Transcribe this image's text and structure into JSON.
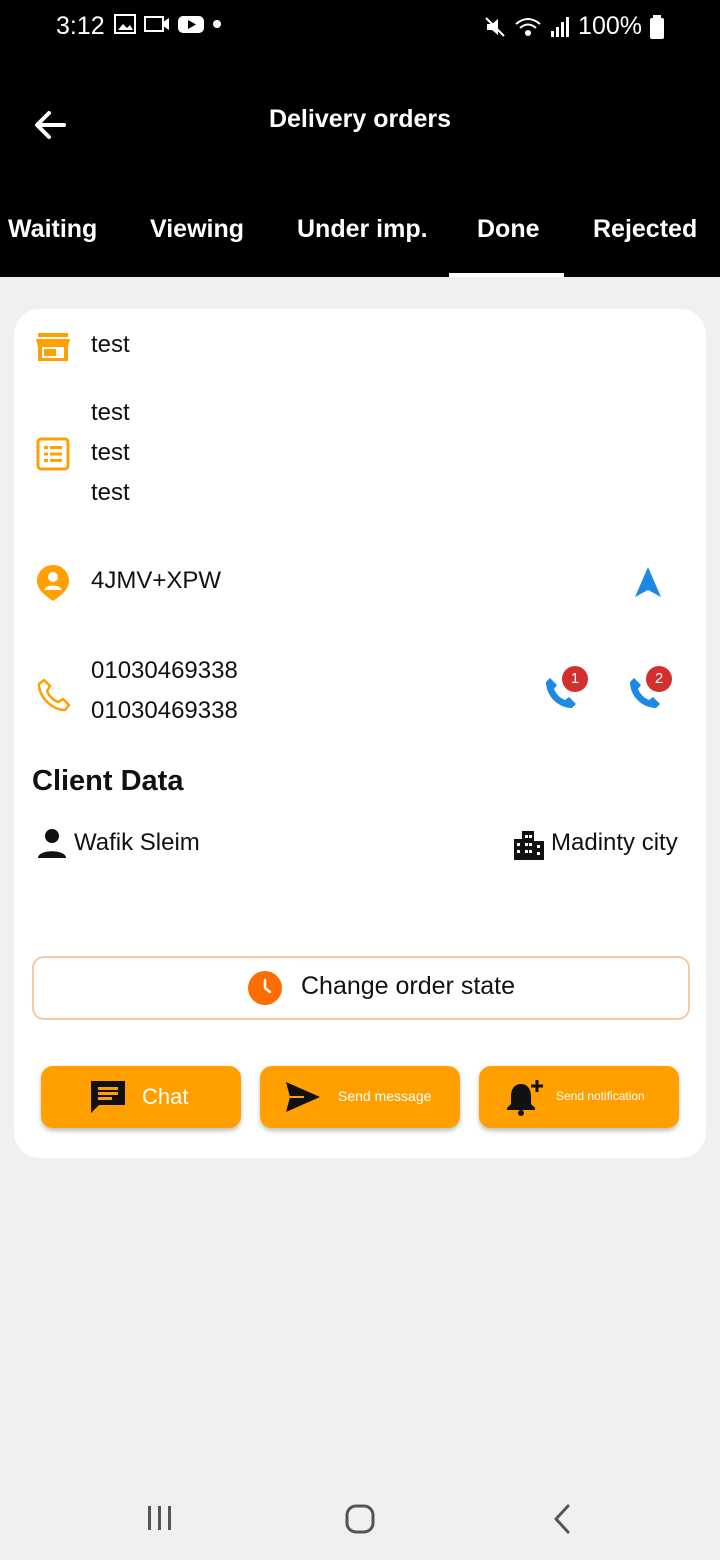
{
  "status_bar": {
    "time": "3:12",
    "battery": "100%"
  },
  "app_bar": {
    "title": "Delivery orders"
  },
  "tabs": [
    {
      "label": "Waiting"
    },
    {
      "label": "Viewing"
    },
    {
      "label": "Under imp."
    },
    {
      "label": "Done",
      "selected": true
    },
    {
      "label": "Rejected"
    }
  ],
  "order": {
    "store_name": "test",
    "items": [
      "test",
      "test",
      "test"
    ],
    "location_code": "4JMV+XPW",
    "phones": [
      "01030469338",
      "01030469338"
    ],
    "call_badges": [
      "1",
      "2"
    ]
  },
  "client": {
    "section_title": "Client Data",
    "name": "Wafik Sleim",
    "city": "Madinty city"
  },
  "actions": {
    "change_state": "Change order state",
    "chat": "Chat",
    "send_message": "Send message",
    "send_notification": "Send notification"
  },
  "colors": {
    "accent": "#ffa000",
    "call_blue": "#1e88e5",
    "badge_red": "#d32f2f",
    "clock_orange": "#ff6d00"
  },
  "icons": [
    "store-icon",
    "list-icon",
    "location-pin-icon",
    "navigation-icon",
    "phone-icon",
    "call-icon",
    "person-icon",
    "city-icon",
    "clock-icon",
    "chat-icon",
    "send-icon",
    "bell-plus-icon"
  ]
}
